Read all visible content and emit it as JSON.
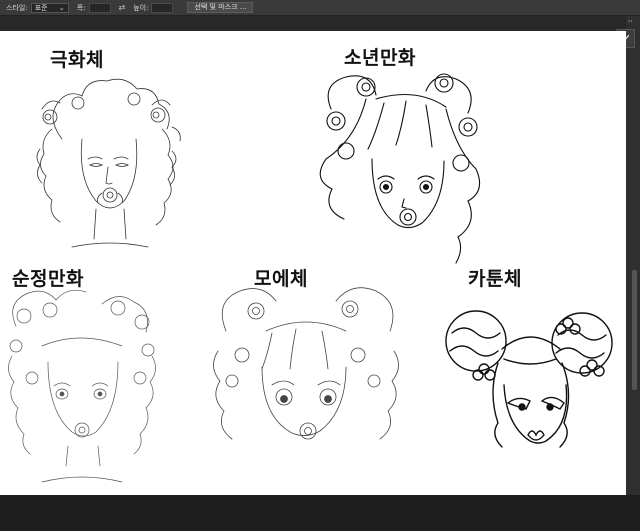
{
  "toolbar": {
    "style_label": "스타일:",
    "style_value": "표준",
    "width_label": "폭:",
    "height_label": "높이:",
    "select_mask_button": "선택 및 마스크 ..."
  },
  "side_panel": {
    "collapse_icon": "double-chevron-icon",
    "tool_icon": "brush-icon"
  },
  "styles": [
    {
      "label": "극화체"
    },
    {
      "label": "소년만화"
    },
    {
      "label": "순정만화"
    },
    {
      "label": "모에체"
    },
    {
      "label": "카툰체"
    }
  ],
  "colors": {
    "canvas": "#ffffff",
    "ui_dark": "#1e1e1e",
    "toolbar": "#3a3a3a",
    "ink": "#111111"
  }
}
